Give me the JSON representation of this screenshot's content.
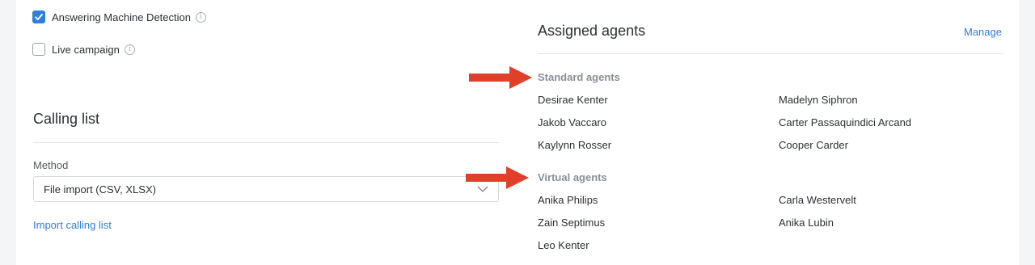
{
  "options": {
    "amd": {
      "label": "Answering Machine Detection",
      "checked": true
    },
    "live": {
      "label": "Live campaign",
      "checked": false
    },
    "info_glyph": "i"
  },
  "calling_list": {
    "title": "Calling list",
    "method_label": "Method",
    "method_value": "File import (CSV, XLSX)",
    "import_link": "Import calling list"
  },
  "assigned": {
    "title": "Assigned agents",
    "manage_link": "Manage",
    "standard": {
      "title": "Standard agents",
      "agents": [
        "Desirae Kenter",
        "Madelyn Siphron",
        "Jakob Vaccaro",
        "Carter Passaquindici Arcand",
        "Kaylynn Rosser",
        "Cooper Carder"
      ]
    },
    "virtual": {
      "title": "Virtual agents",
      "agents": [
        "Anika Philips",
        "Carla Westervelt",
        "Zain Septimus",
        "Anika Lubin",
        "Leo Kenter"
      ]
    }
  },
  "colors": {
    "accent": "#2f7fd8",
    "arrow": "#e0402a"
  }
}
